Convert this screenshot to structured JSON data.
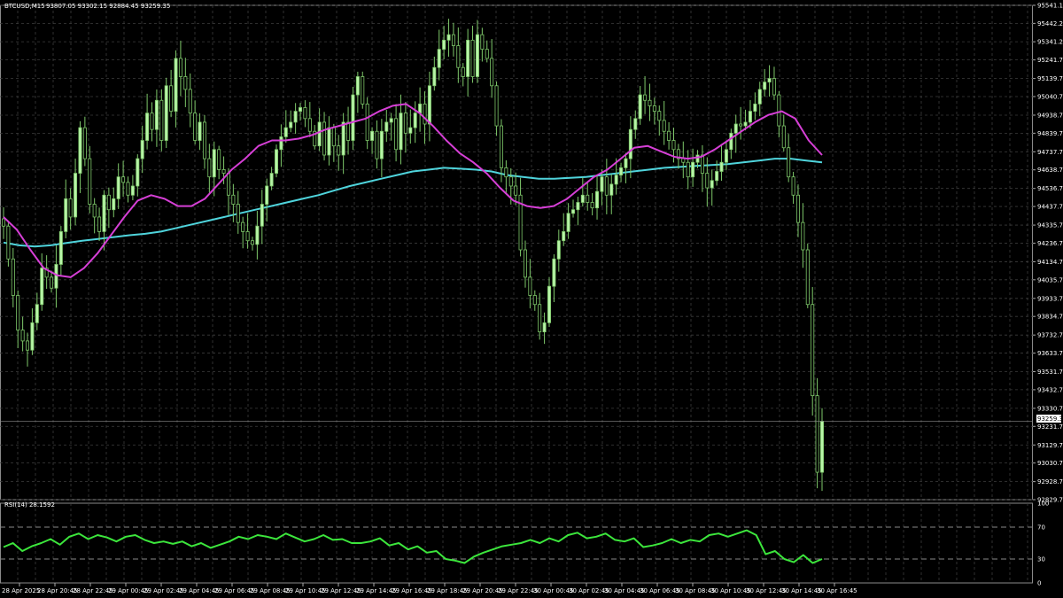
{
  "header": {
    "symbol": "BTCUSD,M15",
    "ohlc": "93807.05 93302.15 92884.45 93259.35"
  },
  "rsi_header": "RSI(14) 28.1592",
  "current_price_label": "93259.35",
  "colors": {
    "background": "#000000",
    "grid": "#3c3c3c",
    "bull": "#b8f5a8",
    "wick": "#7ec86a",
    "ma_fast": "#d63fd6",
    "ma_slow": "#4fd4dc",
    "rsi": "#3ce63c",
    "text": "#ffffff"
  },
  "chart_data": [
    {
      "type": "candlestick",
      "symbol": "BTCUSD",
      "timeframe": "M15",
      "price_axis_labels": [
        "95541.15",
        "95442.20",
        "95341.20",
        "95241.70",
        "95139.70",
        "95040.70",
        "94938.70",
        "94839.70",
        "94737.70",
        "94638.70",
        "94536.70",
        "94437.70",
        "94335.70",
        "94236.70",
        "94134.70",
        "94035.70",
        "93933.70",
        "93834.70",
        "93732.70",
        "93633.70",
        "93531.70",
        "93432.70",
        "93330.70",
        "93231.70",
        "93129.70",
        "93030.70",
        "92928.70",
        "92829.70"
      ],
      "ylim": [
        92829.7,
        95541.15
      ],
      "time_labels": [
        "28 Apr 2025",
        "28 Apr 20:45",
        "28 Apr 22:45",
        "29 Apr 00:45",
        "29 Apr 02:45",
        "29 Apr 04:45",
        "29 Apr 06:45",
        "29 Apr 08:45",
        "29 Apr 10:45",
        "29 Apr 12:45",
        "29 Apr 14:45",
        "29 Apr 16:45",
        "29 Apr 18:45",
        "29 Apr 20:45",
        "29 Apr 22:45",
        "30 Apr 00:45",
        "30 Apr 02:45",
        "30 Apr 04:45",
        "30 Apr 06:45",
        "30 Apr 08:45",
        "30 Apr 10:45",
        "30 Apr 12:45",
        "30 Apr 14:45",
        "30 Apr 16:45"
      ],
      "close_series": [
        94330,
        94150,
        93950,
        93760,
        93700,
        93650,
        93800,
        93900,
        94100,
        94050,
        93990,
        94120,
        94300,
        94480,
        94380,
        94620,
        94870,
        94700,
        94450,
        94380,
        94300,
        94500,
        94420,
        94480,
        94600,
        94570,
        94500,
        94550,
        94700,
        94800,
        94950,
        94860,
        95020,
        94800,
        95100,
        94960,
        95250,
        95150,
        95080,
        94950,
        94800,
        94900,
        94700,
        94600,
        94750,
        94640,
        94620,
        94500,
        94450,
        94350,
        94300,
        94250,
        94230,
        94330,
        94450,
        94550,
        94620,
        94750,
        94820,
        94870,
        94900,
        94960,
        94980,
        94920,
        94850,
        94770,
        94900,
        94720,
        94870,
        94770,
        94720,
        94900,
        94800,
        95050,
        95150,
        95000,
        94800,
        94850,
        94700,
        94850,
        94900,
        94920,
        94750,
        94950,
        94840,
        94870,
        94950,
        95000,
        94890,
        95100,
        95200,
        95300,
        95350,
        95380,
        95320,
        95200,
        95150,
        95350,
        95150,
        95380,
        95300,
        95250,
        95100,
        94880,
        94650,
        94600,
        94550,
        94500,
        94200,
        94050,
        93950,
        93900,
        93750,
        93800,
        94000,
        94150,
        94250,
        94300,
        94400,
        94420,
        94460,
        94500,
        94460,
        94430,
        94520,
        94600,
        94500,
        94560,
        94610,
        94650,
        94700,
        94860,
        94920,
        95050,
        95020,
        94990,
        94960,
        94910,
        94850,
        94800,
        94750,
        94700,
        94680,
        94600,
        94680,
        94720,
        94620,
        94540,
        94580,
        94630,
        94680,
        94750,
        94840,
        94890,
        94880,
        94900,
        94960,
        95000,
        95080,
        95120,
        95140,
        95050,
        94880,
        94760,
        94600,
        94500,
        94350,
        94200,
        93900,
        93400,
        92980,
        93260
      ],
      "ma_fast": [
        94380,
        94310,
        94200,
        94100,
        94060,
        94050,
        94100,
        94180,
        94280,
        94380,
        94470,
        94500,
        94480,
        94440,
        94440,
        94480,
        94560,
        94640,
        94700,
        94770,
        94800,
        94800,
        94810,
        94830,
        94860,
        94880,
        94900,
        94920,
        94960,
        94990,
        95000,
        94950,
        94880,
        94800,
        94730,
        94680,
        94620,
        94540,
        94470,
        94440,
        94430,
        94440,
        94480,
        94540,
        94600,
        94640,
        94700,
        94760,
        94770,
        94740,
        94710,
        94700,
        94710,
        94750,
        94800,
        94850,
        94900,
        94940,
        94960,
        94920,
        94800,
        94720
      ],
      "ma_slow": [
        94240,
        94225,
        94218,
        94225,
        94238,
        94250,
        94260,
        94270,
        94280,
        94288,
        94300,
        94320,
        94340,
        94360,
        94380,
        94400,
        94420,
        94440,
        94460,
        94480,
        94500,
        94525,
        94550,
        94570,
        94590,
        94610,
        94630,
        94640,
        94650,
        94645,
        94640,
        94630,
        94610,
        94600,
        94590,
        94590,
        94595,
        94600,
        94610,
        94620,
        94630,
        94640,
        94650,
        94655,
        94660,
        94665,
        94670,
        94680,
        94690,
        94700,
        94700,
        94690,
        94680
      ],
      "rsi_axis_labels": [
        "100",
        "70",
        "30",
        "0"
      ],
      "rsi_levels": [
        70,
        30
      ],
      "rsi_current": 28.1592,
      "rsi_series": [
        45,
        50,
        40,
        46,
        50,
        55,
        48,
        58,
        62,
        55,
        60,
        57,
        52,
        58,
        60,
        54,
        50,
        52,
        49,
        52,
        46,
        50,
        44,
        48,
        52,
        58,
        55,
        60,
        58,
        55,
        62,
        57,
        52,
        55,
        60,
        54,
        55,
        50,
        50,
        52,
        56,
        47,
        50,
        42,
        46,
        38,
        40,
        30,
        28,
        25,
        33,
        38,
        42,
        46,
        48,
        50,
        54,
        50,
        56,
        52,
        60,
        63,
        56,
        58,
        62,
        54,
        52,
        56,
        45,
        47,
        50,
        55,
        50,
        54,
        52,
        60,
        62,
        58,
        62,
        66,
        60,
        36,
        40,
        30,
        26,
        35,
        25,
        30
      ]
    }
  ]
}
